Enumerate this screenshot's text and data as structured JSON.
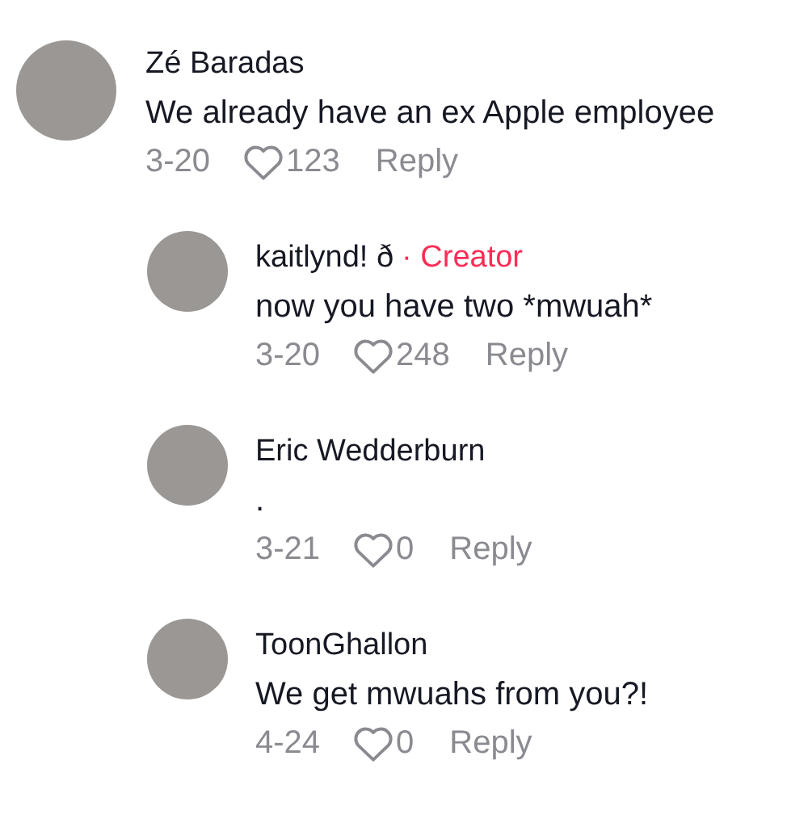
{
  "comments": [
    {
      "author": "Zé Baradas",
      "text": "We already have an ex Apple employee",
      "date": "3-20",
      "likes": "123",
      "reply": "Reply",
      "is_reply": false
    },
    {
      "author": "kaitlynd! ð",
      "creator_label": "· Creator",
      "text": "now you have two *mwuah*",
      "date": "3-20",
      "likes": "248",
      "reply": "Reply",
      "is_reply": true
    },
    {
      "author": "Eric Wedderburn",
      "text": ".",
      "date": "3-21",
      "likes": "0",
      "reply": "Reply",
      "is_reply": true
    },
    {
      "author": "ToonGhallon",
      "text": "We get mwuahs from you?!",
      "date": "4-24",
      "likes": "0",
      "reply": "Reply",
      "is_reply": true
    }
  ]
}
